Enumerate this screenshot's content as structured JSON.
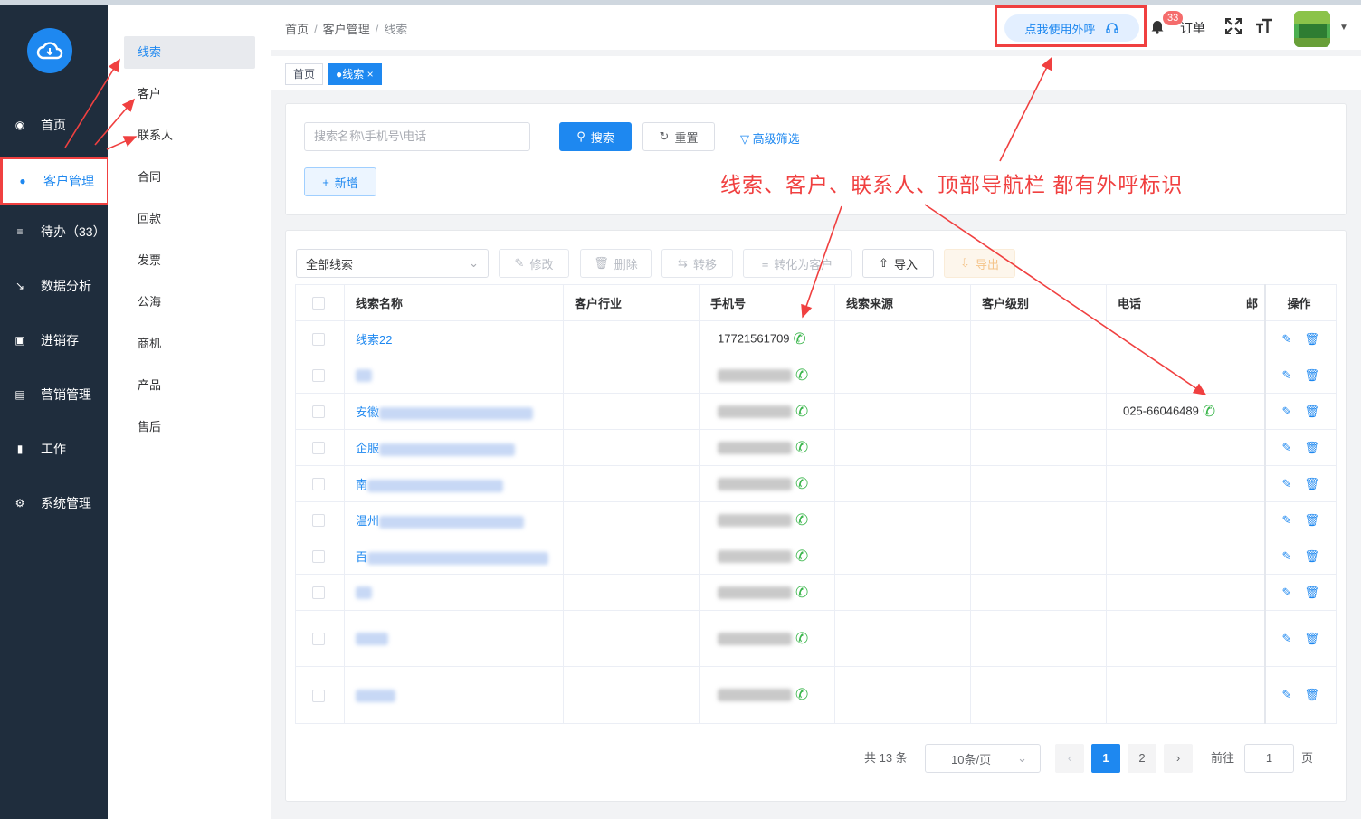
{
  "colors": {
    "brand": "#1e88f0",
    "sidebar": "#1f2d3d",
    "annotation": "#f04040",
    "phone_icon": "#39b54a"
  },
  "nav": {
    "items": [
      {
        "label": "首页",
        "icon": "dashboard-icon"
      },
      {
        "label": "客户管理",
        "icon": "user-icon",
        "active": true
      },
      {
        "label": "待办（33）",
        "icon": "sliders-icon"
      },
      {
        "label": "数据分析",
        "icon": "chart-icon"
      },
      {
        "label": "进销存",
        "icon": "folder-icon"
      },
      {
        "label": "营销管理",
        "icon": "marketing-icon"
      },
      {
        "label": "工作",
        "icon": "book-icon"
      },
      {
        "label": "系统管理",
        "icon": "gear-icon"
      }
    ]
  },
  "submenu": {
    "items": [
      "线索",
      "客户",
      "联系人",
      "合同",
      "回款",
      "发票",
      "公海",
      "商机",
      "产品",
      "售后"
    ]
  },
  "header": {
    "breadcrumb": [
      "首页",
      "客户管理",
      "线索"
    ],
    "call_button": "点我使用外呼",
    "badge": "33",
    "orders": "订单"
  },
  "tabs": [
    "首页",
    "●线索"
  ],
  "search": {
    "placeholder": "搜索名称\\手机号\\电话",
    "search_btn": "搜索",
    "reset_btn": "重置",
    "advanced": "高级筛选",
    "add_btn": "新增"
  },
  "annotation": "线索、客户、联系人、顶部导航栏  都有外呼标识",
  "toolbar": {
    "filter": "全部线索",
    "edit": "修改",
    "delete": "删除",
    "transfer": "转移",
    "convert": "转化为客户",
    "import": "导入",
    "export": "导出"
  },
  "table": {
    "headers": [
      "线索名称",
      "客户行业",
      "手机号",
      "线索来源",
      "客户级别",
      "电话",
      "邮",
      "操作"
    ],
    "rows": [
      {
        "name": "线索22",
        "mobile": "17721561709",
        "phone": ""
      },
      {
        "name": "",
        "mobile": "",
        "phone": ""
      },
      {
        "name": "安徽",
        "mobile": "",
        "phone": "025-66046489"
      },
      {
        "name": "企服",
        "mobile": "",
        "phone": ""
      },
      {
        "name": "南",
        "mobile": "",
        "phone": ""
      },
      {
        "name": "温州",
        "mobile": "",
        "phone": ""
      },
      {
        "name": "百",
        "mobile": "",
        "phone": ""
      },
      {
        "name": "",
        "mobile": "",
        "phone": ""
      },
      {
        "name": "",
        "mobile": "",
        "phone": ""
      },
      {
        "name": "",
        "mobile": "",
        "phone": ""
      }
    ]
  },
  "pagination": {
    "total": "共 13 条",
    "page_size": "10条/页",
    "pages": [
      "1",
      "2"
    ],
    "goto_label": "前往",
    "goto_value": "1",
    "page_unit": "页"
  }
}
